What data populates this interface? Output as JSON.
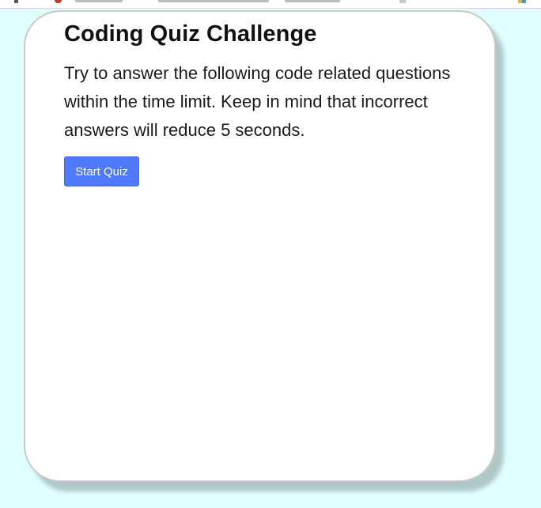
{
  "quiz": {
    "title": "Coding Quiz Challenge",
    "description": "Try to answer the following code related questions within the time limit. Keep in mind that incorrect answers will reduce 5 seconds.",
    "start_button_label": "Start Quiz"
  },
  "colors": {
    "page_background": "#e0ffff",
    "card_background": "#ffffff",
    "button_background": "#4f79ff",
    "button_text": "#ffffff"
  }
}
